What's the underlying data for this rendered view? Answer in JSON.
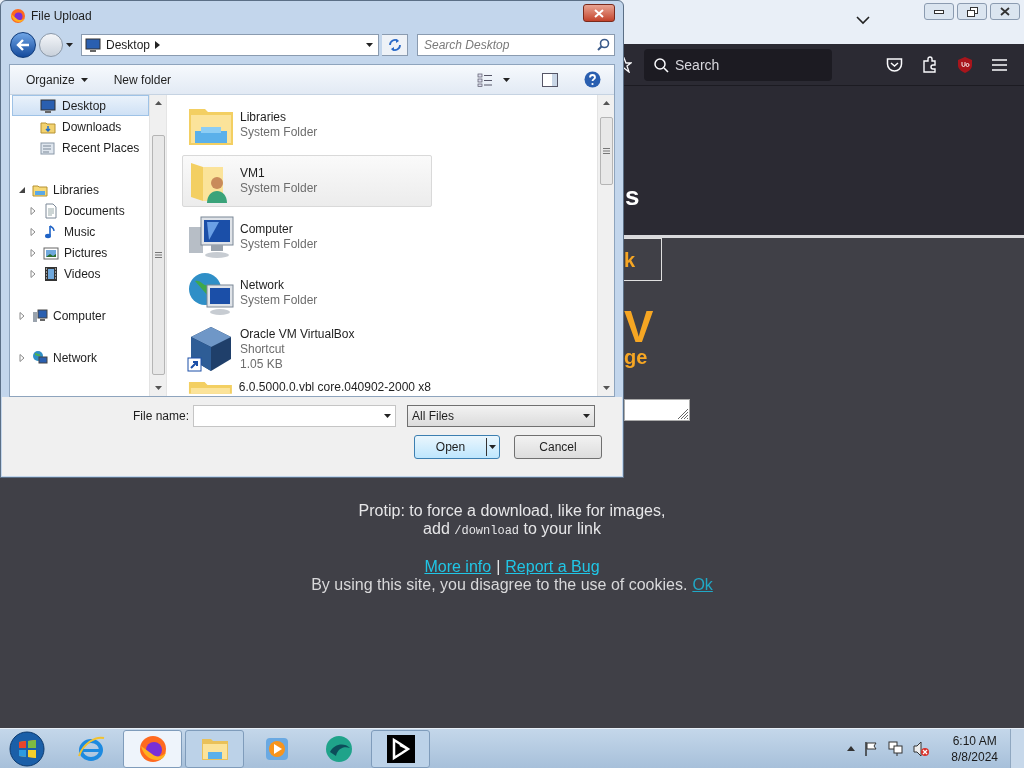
{
  "browser": {
    "search_placeholder": "Search"
  },
  "page": {
    "heading_fragment": "s",
    "button_fragment": "k",
    "logo_fragment": "V",
    "tagline_fragment": "ge",
    "protip": "Protip: to force a download, like for images,",
    "protip_line2": {
      "before": "add",
      "code": "/download",
      "after": "to your link"
    },
    "links": [
      {
        "text": "More info"
      },
      {
        "text": "Report a Bug"
      }
    ],
    "link_separator": "|",
    "cookie_text": "By using this site, you disagree to the use of cookies.",
    "cookie_link": "Ok"
  },
  "dialog": {
    "title": "File Upload",
    "address": "Desktop",
    "search_placeholder": "Search Desktop",
    "commands": [
      {
        "label": "Organize",
        "kind": "menu"
      },
      {
        "label": "New folder",
        "kind": "plain"
      }
    ],
    "favorites": [
      {
        "label": "Desktop",
        "kind": "desktop",
        "selected": true
      },
      {
        "label": "Downloads",
        "kind": "downloads",
        "selected": false
      },
      {
        "label": "Recent Places",
        "kind": "recent",
        "selected": false
      }
    ],
    "tree": [
      {
        "label": "Libraries",
        "kind": "library",
        "selected": false,
        "expanded": true,
        "children": [
          {
            "label": "Documents",
            "kind": "documents",
            "selected": false,
            "expanded": false
          },
          {
            "label": "Music",
            "kind": "music",
            "selected": false,
            "expanded": false
          },
          {
            "label": "Pictures",
            "kind": "pictures",
            "selected": false,
            "expanded": false
          },
          {
            "label": "Videos",
            "kind": "videos",
            "selected": false,
            "expanded": false
          }
        ]
      },
      {
        "label": "Computer",
        "kind": "computer",
        "selected": false,
        "expanded": false
      },
      {
        "label": "Network",
        "kind": "network",
        "selected": false,
        "expanded": false
      }
    ],
    "files": [
      {
        "name": "Libraries",
        "details": [
          "System Folder"
        ],
        "kind": "library",
        "selected": false
      },
      {
        "name": "VM1",
        "details": [
          "System Folder"
        ],
        "kind": "user",
        "selected": true
      },
      {
        "name": "Computer",
        "details": [
          "System Folder"
        ],
        "kind": "computer",
        "selected": false
      },
      {
        "name": "Network",
        "details": [
          "System Folder"
        ],
        "kind": "network",
        "selected": false
      },
      {
        "name": "Oracle VM VirtualBox",
        "details": [
          "Shortcut",
          "1.05 KB"
        ],
        "kind": "shortcut",
        "selected": false
      },
      {
        "name": "6.0.5000.0.vbl  core.040902-2000  x8",
        "kind": "folder",
        "selected": false
      }
    ],
    "file_name_label": "File name:",
    "filter": "All Files",
    "buttons": [
      {
        "label": "Open",
        "kind": "split"
      },
      {
        "label": "Cancel",
        "kind": "plain"
      }
    ]
  },
  "taskbar": {
    "apps": [
      {
        "kind": "ie",
        "selected": false,
        "running": false
      },
      {
        "kind": "firefox",
        "selected": true,
        "running": true
      },
      {
        "kind": "explorer",
        "selected": false,
        "running": true
      },
      {
        "kind": "media",
        "selected": false,
        "running": false
      },
      {
        "kind": "green",
        "selected": false,
        "running": false
      },
      {
        "kind": "black",
        "selected": false,
        "running": true
      }
    ],
    "time": "6:10 AM",
    "date": "8/8/2024"
  }
}
